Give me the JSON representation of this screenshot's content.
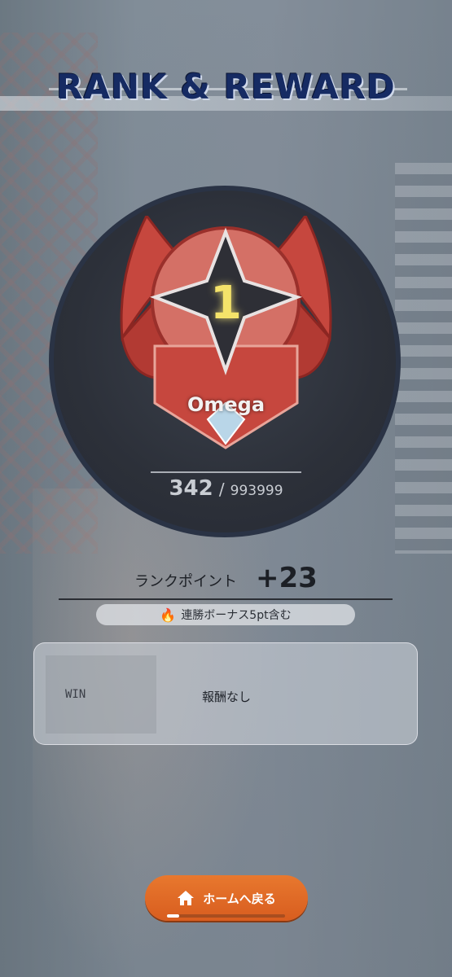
{
  "header": {
    "title": "RANK & REWARD"
  },
  "rank": {
    "tier_name": "Omega",
    "tier_number": "1",
    "points_current": "342",
    "points_separator": "/",
    "points_max": "993999"
  },
  "rank_points": {
    "label": "ランクポイント",
    "value": "+23",
    "bonus_text": "連勝ボーナス5pt含む"
  },
  "reward": {
    "result_label": "WIN",
    "reward_text": "報酬なし"
  },
  "footer": {
    "home_button_label": "ホームへ戻る",
    "progress_fraction": 0.1
  },
  "colors": {
    "accent": "#e8782e",
    "title": "#162b63",
    "emblem_red": "#c6473e",
    "emblem_gold": "#f4e36a"
  },
  "icons": {
    "flame": "flame-icon",
    "home": "home-icon"
  }
}
